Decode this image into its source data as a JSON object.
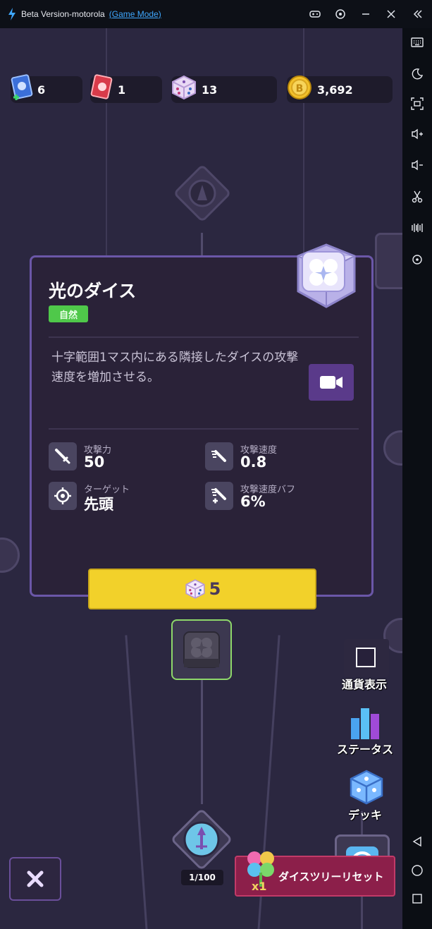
{
  "titlebar": {
    "app_name": "Beta Version-motorola",
    "mode": "(Game Mode)",
    "buttons": [
      "gamepad-icon",
      "record-icon",
      "minimize-icon",
      "close-icon"
    ]
  },
  "sidebar": {
    "icons": [
      "keyboard-icon",
      "night-mode-icon",
      "screenshot-icon",
      "volume-up-icon",
      "volume-down-icon",
      "scissors-icon",
      "vibrate-icon",
      "location-icon",
      "back-icon",
      "home-icon",
      "recents-icon"
    ]
  },
  "currencies": [
    {
      "name": "blue-card",
      "value": "6",
      "color": "#3b6fd8"
    },
    {
      "name": "red-card",
      "value": "1",
      "color": "#d83b4a"
    },
    {
      "name": "dice",
      "value": "13",
      "color": "#e9d9f5"
    },
    {
      "name": "gold-coin",
      "value": "3,692",
      "color": "#f2c02a"
    }
  ],
  "card": {
    "title": "光のダイス",
    "tag": "自然",
    "description": "十字範囲1マス内にある隣接したダイスの攻撃速度を増加させる。",
    "stats": [
      {
        "label": "攻撃力",
        "value": "50",
        "icon": "sword-icon"
      },
      {
        "label": "攻撃速度",
        "value": "0.8",
        "icon": "attack-speed-icon"
      },
      {
        "label": "ターゲット",
        "value": "先頭",
        "icon": "target-icon"
      },
      {
        "label": "攻撃速度バフ",
        "value": "6%",
        "icon": "attack-speed-buff-icon"
      }
    ],
    "buy_cost": "5"
  },
  "side_menu": {
    "currency_display": "通貨表示",
    "status": "ステータス",
    "deck": "デッキ"
  },
  "tree": {
    "progress": "1/100"
  },
  "reset": {
    "multiplier": "x1",
    "label": "ダイスツリーリセット"
  },
  "colors": {
    "accent": "#6b57a8",
    "buy_button": "#f2d12a",
    "reset_button": "#8c1f4a",
    "tag_green": "#4fc84a"
  }
}
